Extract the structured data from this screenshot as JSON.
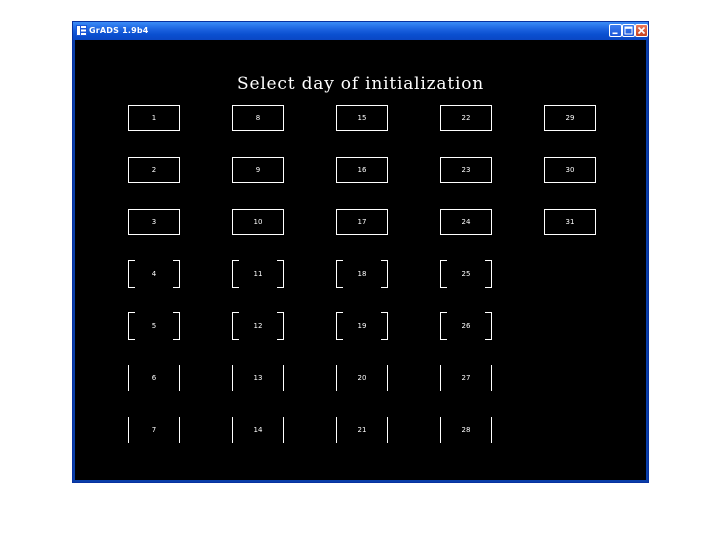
{
  "window": {
    "title": "GrADS 1.9b4",
    "controls": [
      "minimize-icon",
      "maximize-icon",
      "close-icon"
    ]
  },
  "canvas": {
    "heading": "Select day of initialization",
    "days": [
      "1",
      "2",
      "3",
      "4",
      "5",
      "6",
      "7",
      "8",
      "9",
      "10",
      "11",
      "12",
      "13",
      "14",
      "15",
      "16",
      "17",
      "18",
      "19",
      "20",
      "21",
      "22",
      "23",
      "24",
      "25",
      "26",
      "27",
      "28",
      "29",
      "30",
      "31"
    ]
  },
  "colors": {
    "titlebar": "#1c63e0",
    "canvas_bg": "#000000",
    "foreground": "#ffffff"
  }
}
